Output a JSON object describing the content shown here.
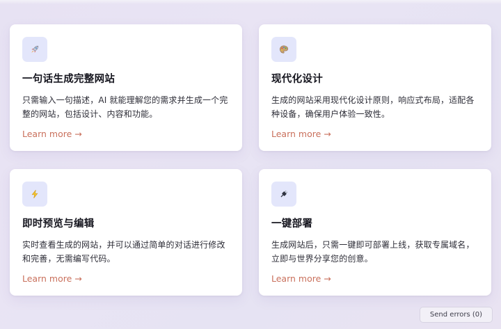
{
  "features": [
    {
      "icon": "rocket-icon",
      "title": "一句话生成完整网站",
      "description": "只需输入一句描述，AI 就能理解您的需求并生成一个完整的网站，包括设计、内容和功能。",
      "link": "Learn more →"
    },
    {
      "icon": "palette-icon",
      "title": "现代化设计",
      "description": "生成的网站采用现代化设计原则，响应式布局，适配各种设备，确保用户体验一致性。",
      "link": "Learn more →"
    },
    {
      "icon": "lightning-icon",
      "title": "即时预览与编辑",
      "description": "实时查看生成的网站，并可以通过简单的对话进行修改和完善，无需编写代码。",
      "link": "Learn more →"
    },
    {
      "icon": "plug-icon",
      "title": "一键部署",
      "description": "生成网站后，只需一键即可部署上线，获取专属域名，立即与世界分享您的创意。",
      "link": "Learn more →"
    }
  ],
  "send_errors": {
    "label": "Send errors (0)"
  },
  "colors": {
    "accent_link": "#c9705c",
    "icon_background": "#e3e6fb",
    "page_background": "#e8e3f3"
  }
}
